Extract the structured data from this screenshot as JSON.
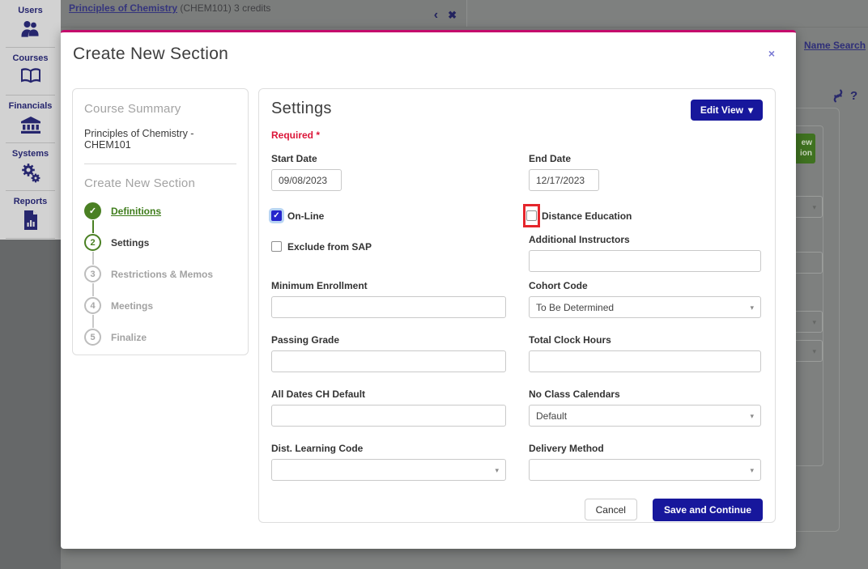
{
  "icons": {
    "check": "✓",
    "caret_down": "▾",
    "chevron_left": "‹",
    "close_x": "✖",
    "modal_close": "×",
    "question": "?"
  },
  "colors": {
    "accent_navy": "#17179c",
    "modal_top_magenta": "#c40a6c",
    "step_green": "#4a8023",
    "highlight_red": "#e5262c",
    "required_red": "#dc1639",
    "checkbox_checked_blue": "#2626cc"
  },
  "sidebar": {
    "items": [
      {
        "label": "Users"
      },
      {
        "label": "Courses"
      },
      {
        "label": "Financials"
      },
      {
        "label": "Systems"
      },
      {
        "label": "Reports"
      }
    ]
  },
  "topbar": {
    "course_link": "Principles of Chemistry",
    "course_suffix": " (CHEM101) 3 credits"
  },
  "background": {
    "name_search": "Name Search",
    "green_button_line1": "ew",
    "green_button_line2": "ion"
  },
  "modal": {
    "title": "Create New Section",
    "summary": {
      "heading": "Course Summary",
      "course": "Principles of Chemistry - CHEM101",
      "steps_heading": "Create New Section",
      "steps": [
        {
          "num": "1",
          "label": "Definitions"
        },
        {
          "num": "2",
          "label": "Settings"
        },
        {
          "num": "3",
          "label": "Restrictions & Memos"
        },
        {
          "num": "4",
          "label": "Meetings"
        },
        {
          "num": "5",
          "label": "Finalize"
        }
      ]
    },
    "settings": {
      "heading": "Settings",
      "edit_view_label": "Edit View",
      "required_label": "Required *",
      "fields": {
        "start_date": {
          "label": "Start Date",
          "value": "09/08/2023"
        },
        "end_date": {
          "label": "End Date",
          "value": "12/17/2023"
        },
        "online": {
          "label": "On-Line",
          "checked": true
        },
        "distance_education": {
          "label": "Distance Education",
          "checked": false
        },
        "exclude_sap": {
          "label": "Exclude from SAP",
          "checked": false
        },
        "additional_instructors": {
          "label": "Additional Instructors",
          "value": ""
        },
        "minimum_enrollment": {
          "label": "Minimum Enrollment",
          "value": ""
        },
        "cohort_code": {
          "label": "Cohort Code",
          "value": "To Be Determined"
        },
        "passing_grade": {
          "label": "Passing Grade",
          "value": ""
        },
        "total_clock_hours": {
          "label": "Total Clock Hours",
          "value": ""
        },
        "all_dates_ch_default": {
          "label": "All Dates CH Default",
          "value": ""
        },
        "no_class_calendars": {
          "label": "No Class Calendars",
          "value": "Default"
        },
        "dist_learning_code": {
          "label": "Dist. Learning Code",
          "value": ""
        },
        "delivery_method": {
          "label": "Delivery Method",
          "value": ""
        }
      },
      "buttons": {
        "cancel": "Cancel",
        "save": "Save and Continue"
      }
    }
  }
}
